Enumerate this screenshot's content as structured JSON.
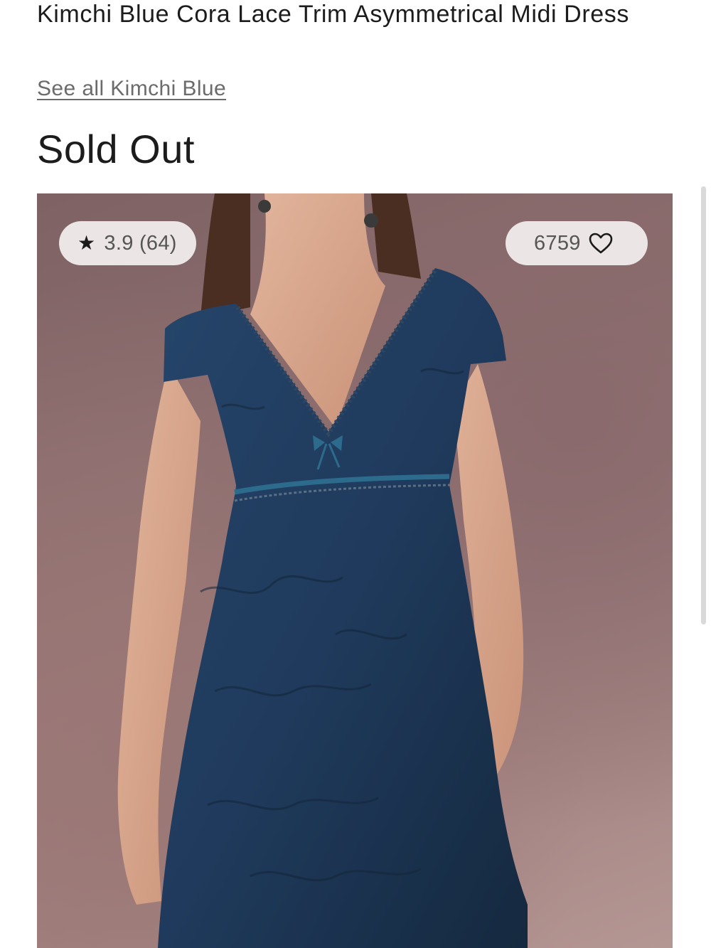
{
  "product": {
    "title": "Kimchi Blue Cora Lace Trim Asymmetrical Midi Dress",
    "brand_link": "See all Kimchi Blue",
    "status": "Sold Out"
  },
  "image": {
    "alt": "Model wearing a navy lace trim midi dress"
  },
  "rating": {
    "icon": "star-icon",
    "value": "3.9",
    "count_text": "(64)",
    "display": "3.9 (64)"
  },
  "wishlist": {
    "icon": "heart-icon",
    "count": "6759"
  },
  "colors": {
    "dress": "#1f3a5c",
    "background": "#8f7071",
    "pill": "#f0ecec",
    "accent_ribbon": "#2d6b8c"
  }
}
